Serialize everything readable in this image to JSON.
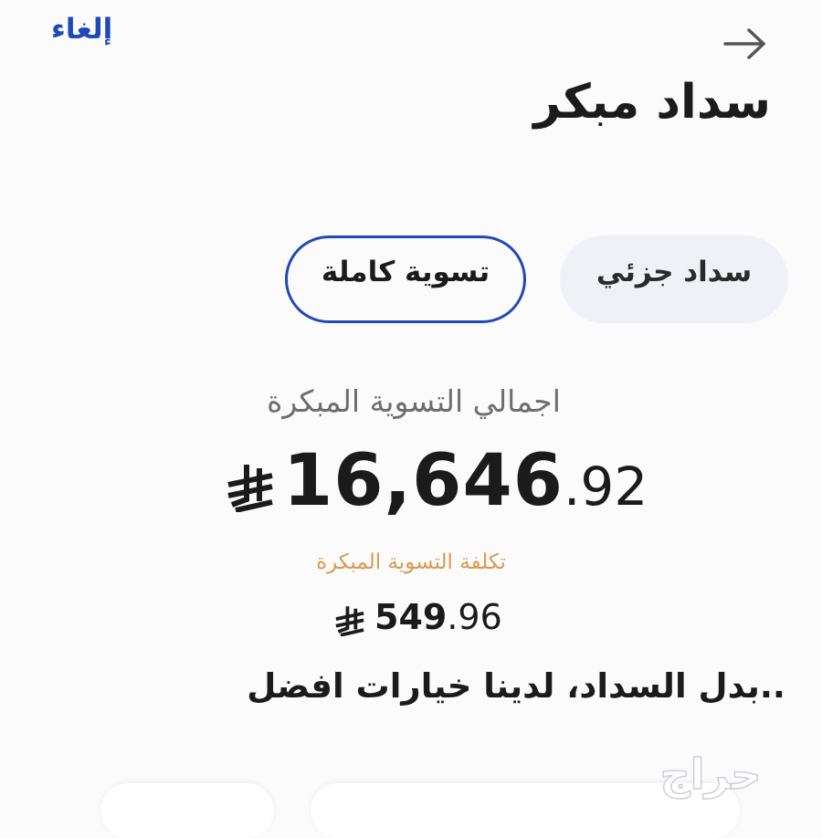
{
  "header": {
    "cancel_label": "إلغاء",
    "back_icon": "arrow-right-icon",
    "title": "سداد مبكر"
  },
  "tabs": [
    {
      "label": "تسوية كاملة",
      "selected": true
    },
    {
      "label": "سداد جزئي",
      "selected": false
    }
  ],
  "summary": {
    "total_label": "اجمالي التسوية المبكرة",
    "total_integer": "16,646",
    "total_decimal": ".92",
    "cost_label": "تكلفة التسوية المبكرة",
    "cost_integer": "549",
    "cost_decimal": ".96",
    "currency_icon": "saudi-riyal-icon"
  },
  "overlay_caption": "..بدل السداد، لدينا خيارات افضل",
  "watermark_text": "حراج",
  "colors": {
    "accent": "#1f49b8",
    "muted_text": "#6e6e6e",
    "cost_label": "#d89a52",
    "tab_inactive_bg": "#f0f1f6"
  }
}
